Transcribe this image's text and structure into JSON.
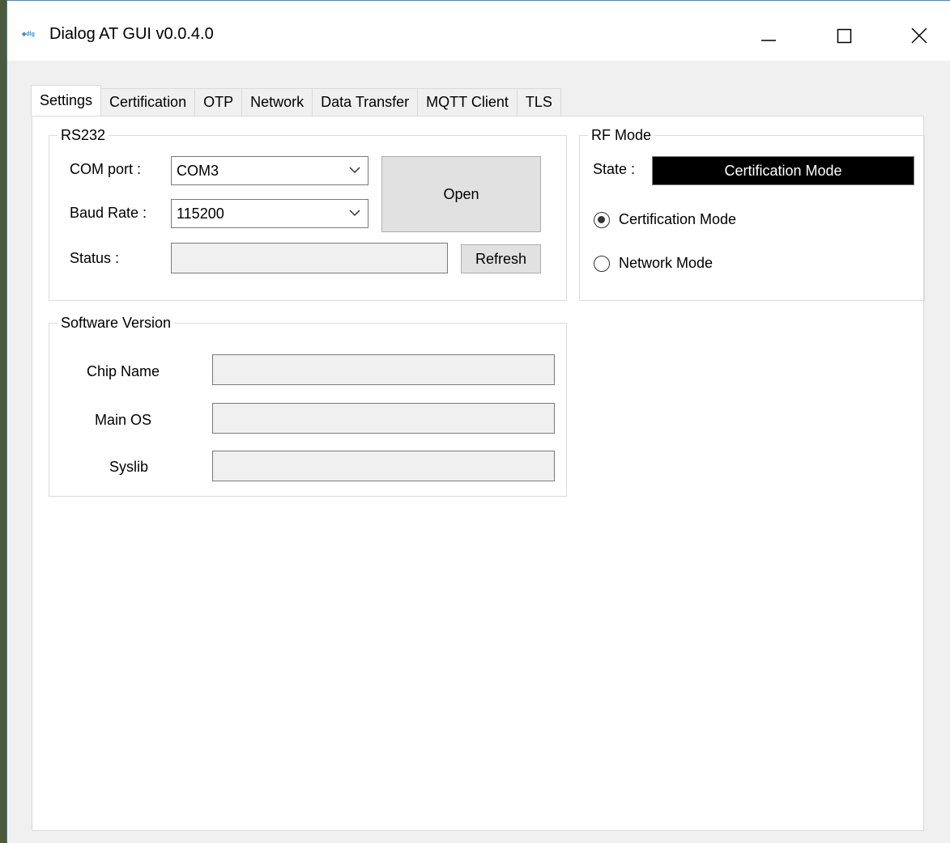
{
  "window": {
    "title": "Dialog AT GUI v0.0.4.0",
    "icon": "dialog-logo-icon"
  },
  "tabs": [
    {
      "label": "Settings",
      "active": true
    },
    {
      "label": "Certification",
      "active": false
    },
    {
      "label": "OTP",
      "active": false
    },
    {
      "label": "Network",
      "active": false
    },
    {
      "label": "Data Transfer",
      "active": false
    },
    {
      "label": "MQTT Client",
      "active": false
    },
    {
      "label": "TLS",
      "active": false
    }
  ],
  "rs232": {
    "legend": "RS232",
    "com_port_label": "COM port :",
    "com_port_value": "COM3",
    "baud_rate_label": "Baud Rate :",
    "baud_rate_value": "115200",
    "status_label": "Status :",
    "status_value": "",
    "open_button": "Open",
    "refresh_button": "Refresh"
  },
  "rf_mode": {
    "legend": "RF Mode",
    "state_label": "State :",
    "state_value": "Certification Mode",
    "options": [
      {
        "label": "Certification Mode",
        "selected": true
      },
      {
        "label": "Network Mode",
        "selected": false
      }
    ]
  },
  "software_version": {
    "legend": "Software Version",
    "chip_name_label": "Chip Name",
    "chip_name_value": "",
    "main_os_label": "Main OS",
    "main_os_value": "",
    "syslib_label": "Syslib",
    "syslib_value": ""
  },
  "colors": {
    "state_bg": "#000000",
    "state_fg": "#ffffff",
    "window_bg": "#f0f0f0"
  }
}
